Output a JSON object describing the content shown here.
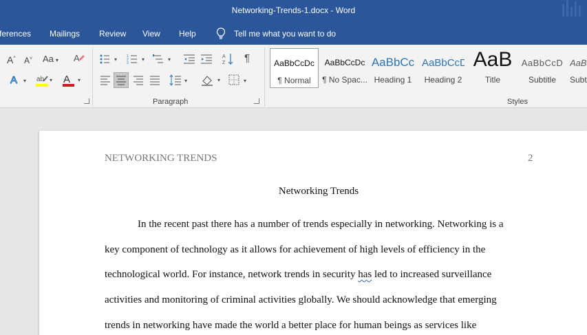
{
  "window": {
    "title": "Networking-Trends-1.docx  -  Word"
  },
  "menu": {
    "items": [
      "ferences",
      "Mailings",
      "Review",
      "View",
      "Help"
    ],
    "tell_me": "Tell me what you want to do"
  },
  "ribbon": {
    "font_size_up": "A",
    "font_size_down": "A",
    "change_case": "Aa",
    "paragraph_group_label": "Paragraph",
    "styles_group_label": "Styles",
    "show_marks": "¶",
    "styles": [
      {
        "sample": "AaBbCcDc",
        "label": "¶ Normal"
      },
      {
        "sample": "AaBbCcDc",
        "label": "¶ No Spac..."
      },
      {
        "sample": "AaBbCc",
        "label": "Heading 1"
      },
      {
        "sample": "AaBbCcD",
        "label": "Heading 2"
      },
      {
        "sample": "AaB",
        "label": "Title"
      },
      {
        "sample": "AaBbCcD",
        "label": "Subtitle"
      },
      {
        "sample": "AaB",
        "label": "Subt"
      }
    ],
    "colors": {
      "highlight": "#ffff00",
      "font_color": "#d11a1a",
      "accent": "#2b579a"
    }
  },
  "document": {
    "running_head": "NETWORKING TRENDS",
    "page_number": "2",
    "title": "Networking Trends",
    "lines": [
      "In the recent past there has a number of trends especially in networking. Networking is a",
      "key component of technology as it allows for achievement of high levels of efficiency in the",
      "technological world. For instance, network trends in security ",
      "has",
      " led to increased surveillance",
      "activities and monitoring of criminal activities globally. We should acknowledge that emerging",
      "trends in networking have made the world a better place for human beings as services like"
    ]
  }
}
